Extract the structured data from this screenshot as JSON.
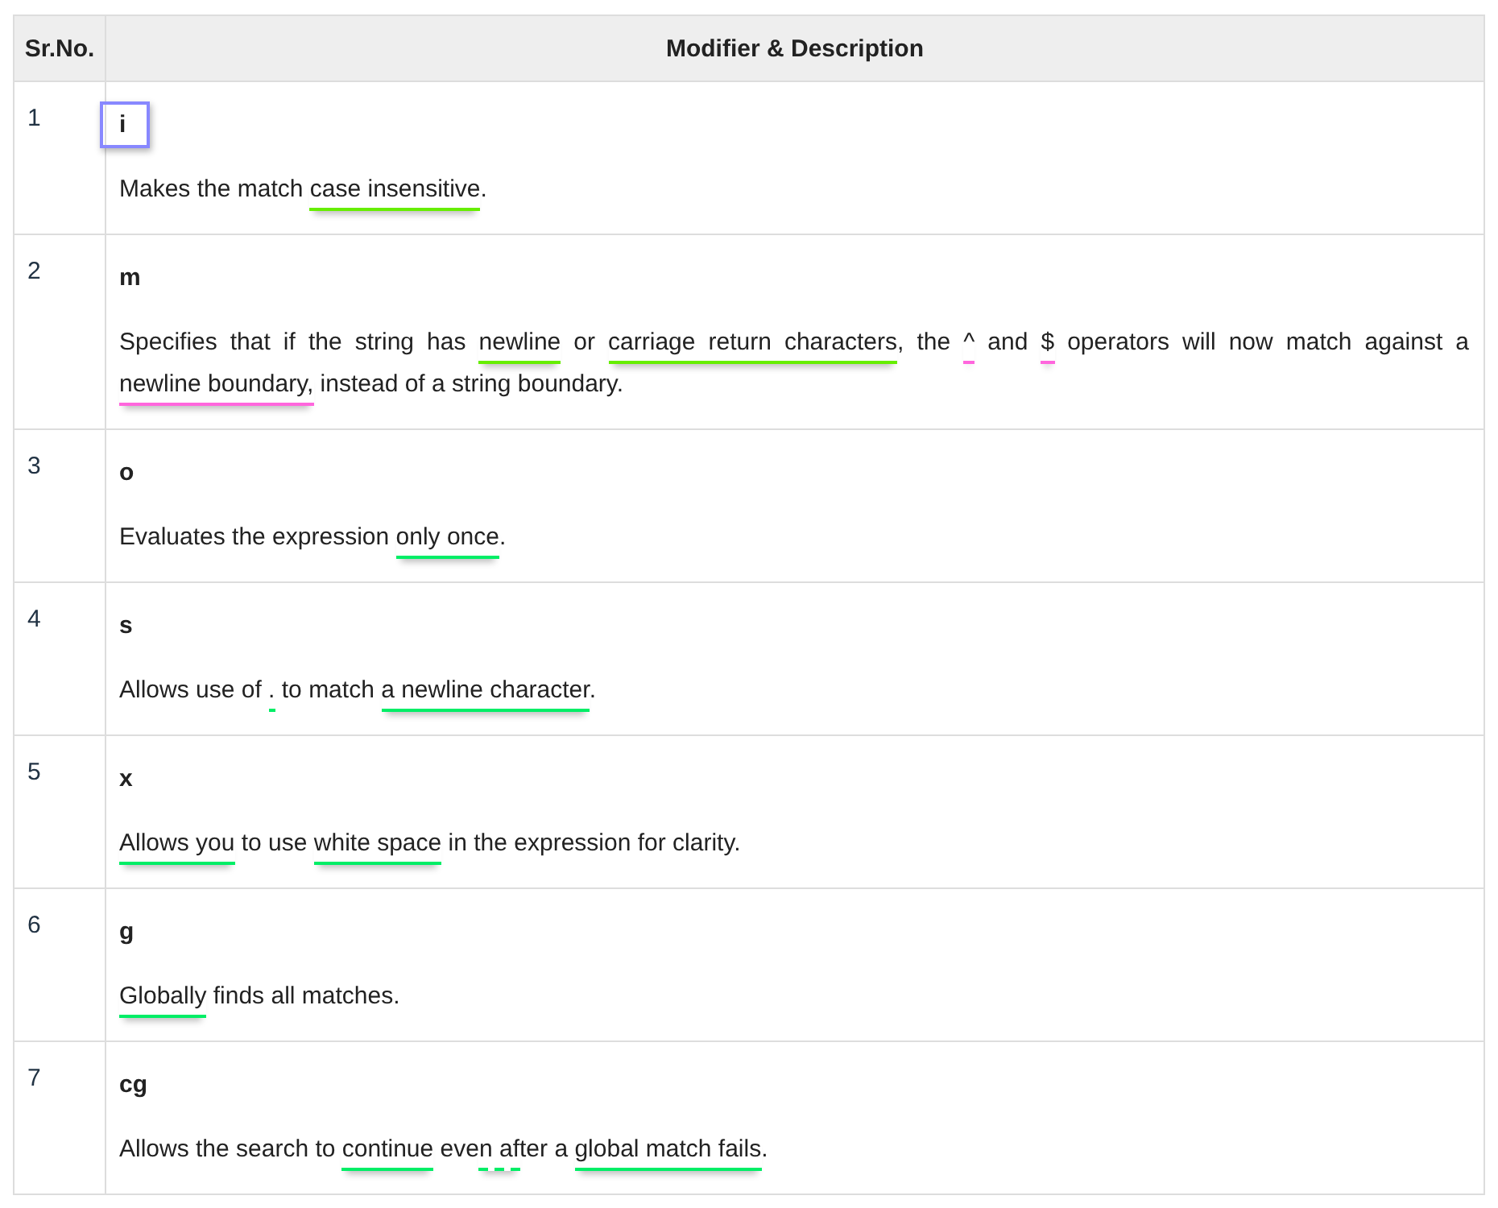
{
  "table": {
    "columns": [
      "Sr.No.",
      "Modifier & Description"
    ],
    "rows": [
      {
        "number": "1",
        "modifier": "i",
        "boxed": true,
        "description": [
          {
            "text": "Makes the match "
          },
          {
            "text": "case insensitive",
            "color": "#66ee00"
          },
          {
            "text": "."
          }
        ]
      },
      {
        "number": "2",
        "modifier": "m",
        "boxed": false,
        "description": [
          {
            "text": "Specifies that if the string has "
          },
          {
            "text": "newline",
            "color": "#66ee00"
          },
          {
            "text": " or "
          },
          {
            "text": "carriage return characters",
            "color": "#66ee00"
          },
          {
            "text": ", the "
          },
          {
            "text": "^",
            "color": "#ff66dd"
          },
          {
            "text": " and "
          },
          {
            "text": "$",
            "color": "#ff66dd"
          },
          {
            "text": " operators will now match against a "
          },
          {
            "text": "newline boundary,",
            "color": "#ff66dd"
          },
          {
            "text": " instead of a string boundary."
          }
        ]
      },
      {
        "number": "3",
        "modifier": "o",
        "boxed": false,
        "description": [
          {
            "text": "Evaluates the expression "
          },
          {
            "text": "only once",
            "color": "#00ee66"
          },
          {
            "text": "."
          }
        ]
      },
      {
        "number": "4",
        "modifier": "s",
        "boxed": false,
        "description": [
          {
            "text": "Allows use of "
          },
          {
            "text": ".",
            "color": "#00ee66"
          },
          {
            "text": " to match "
          },
          {
            "text": "a newline character",
            "color": "#00ee66"
          },
          {
            "text": "."
          }
        ]
      },
      {
        "number": "5",
        "modifier": "x",
        "boxed": false,
        "description": [
          {
            "text": "Allows you",
            "color": "#00ee66"
          },
          {
            "text": " to use "
          },
          {
            "text": "white space",
            "color": "#00ee66"
          },
          {
            "text": " in the expression for clarity."
          }
        ]
      },
      {
        "number": "6",
        "modifier": "g",
        "boxed": false,
        "description": [
          {
            "text": "Globally",
            "color": "#00ee66"
          },
          {
            "text": " finds all matches."
          }
        ]
      },
      {
        "number": "7",
        "modifier": "cg",
        "boxed": false,
        "description": [
          {
            "text": "Allows the search to "
          },
          {
            "text": "continue",
            "color": "#00ee66"
          },
          {
            "text": " eve"
          },
          {
            "text": "n af",
            "color": "#00ee66",
            "dashed": true
          },
          {
            "text": "ter a "
          },
          {
            "text": "global match fails",
            "color": "#00ee66"
          },
          {
            "text": "."
          }
        ]
      }
    ]
  }
}
